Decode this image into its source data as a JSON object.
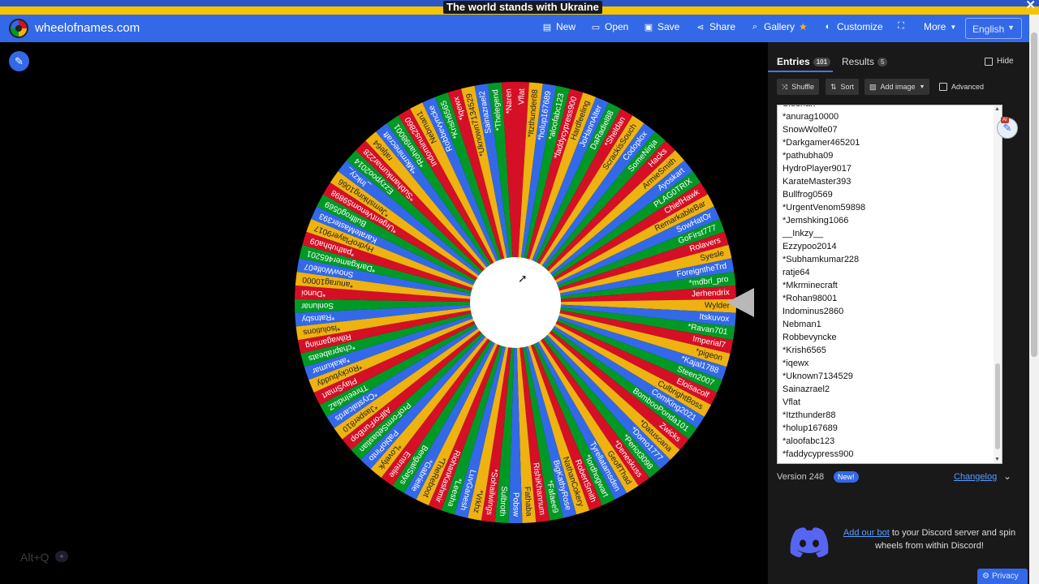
{
  "banner": {
    "text": "The world stands with Ukraine",
    "close": "✕"
  },
  "header": {
    "site_name": "wheelofnames.com",
    "nav": [
      {
        "label": "New",
        "icon": "file-icon"
      },
      {
        "label": "Open",
        "icon": "folder-icon"
      },
      {
        "label": "Save",
        "icon": "save-icon"
      },
      {
        "label": "Share",
        "icon": "share-icon"
      },
      {
        "label": "Gallery",
        "icon": "search-icon"
      },
      {
        "label": "Customize",
        "icon": "palette-icon"
      },
      {
        "label": "",
        "icon": "fullscreen-icon"
      },
      {
        "label": "More",
        "icon": "caret-down-icon"
      }
    ],
    "language": "English"
  },
  "left": {
    "shortcut": "Alt+Q",
    "shortcut_dot": "✦"
  },
  "wheel": {
    "colors": [
      "#d50f25",
      "#eeb211",
      "#3369e8",
      "#009925"
    ],
    "segments": 101,
    "labels": [
      "Vflat",
      "*Itzthunder88",
      "*holup167689",
      "*aloofabc123",
      "*faddycypress900",
      "Hardfeeling",
      "JoHannAlter",
      "DaRadiel88",
      "*Sheldan",
      "ScrackisSouch",
      "Codoplox",
      "SomeNinja",
      "Hacks",
      "ArmieSmith",
      "Ayoskart",
      "PLAG0TRIX",
      "ChiefHawk",
      "RemarkableBar",
      "SowHatOr",
      "GoFirst777",
      "Rolavers",
      "Syesle",
      "ForeigntheTrd",
      "*mdbrl_pro",
      "Jerhendrix",
      "Wylder",
      "Itskuvox",
      "*Ravan701",
      "Imperial7",
      "*pigeon",
      "*Kajal1788",
      "Steen2007",
      "Eloisacolf",
      "CulbrightBoss",
      "ComKing2021",
      "BombooPonda101",
      "Zwicks",
      "*Datuscana",
      "*Domo1777",
      "*Periot3098",
      "*Deneskuss",
      "GeoffThad",
      "Tyrellatamsden",
      "*lordhogwart",
      "RobertSmith",
      "NathanCokery",
      "BigKathyRose",
      "*Fafaee9",
      "RishiKhannum",
      "Fathaba",
      "Pobsw",
      "Sulbroth",
      "*Sohailwings",
      "*Vrkhz",
      "LuvGanesh",
      "*Leesha",
      "RiohanKashmir",
      "*TheReboot",
      "*Gabrielle",
      "BengaliSays",
      "Entrrelie",
      "*Lovelyk",
      "PabloPinto",
      "ProFormSebastian",
      "AllForFunBop",
      "*Jasper810",
      "*Crystalcards",
      "ThreeIndiaZ",
      "PlaySmart",
      "*Rockybuddy",
      "*akakumar",
      "*chaprabeats",
      "Rilwagaming",
      "*lsolutions",
      "*Ratnsby",
      "Sonlunar",
      "*Dunoi",
      "*anurag10000",
      "SnowWolfe07",
      "*Darkgamer465201",
      "*pathubha09",
      "HydroPlayer9017",
      "KarateMaster393",
      "Bullfrog0569",
      "*UrgentVenom59898",
      "*Jemshking1066",
      "_Inkzy_",
      "Ezzypoo2014",
      "*Subhamkumar228",
      "ratje64",
      "*Mkrminecraft",
      "*Rohan98001",
      "Indominus2860",
      "Nebman1",
      "Robbevyncke",
      "*Krish6565",
      "*iqewx",
      "*Uknown7134529",
      "Sainazrael2",
      "*Thelegend",
      "*Naren"
    ]
  },
  "panel": {
    "tabs": [
      {
        "label": "Entries",
        "count": "101"
      },
      {
        "label": "Results",
        "count": "5"
      }
    ],
    "hide_label": "Hide",
    "tools": {
      "shuffle": "Shuffle",
      "sort": "Sort",
      "add_image": "Add image",
      "advanced": "Advanced"
    },
    "entries": [
      "Siddhah",
      "*anurag10000",
      "SnowWolfe07",
      "*Darkgamer465201",
      "*pathubha09",
      "HydroPlayer9017",
      "KarateMaster393",
      "Bullfrog0569",
      "*UrgentVenom59898",
      "*Jemshking1066",
      "__Inkzy__",
      "Ezzypoo2014",
      "*Subhamkumar228",
      "ratje64",
      "*Mkrminecraft",
      "*Rohan98001",
      "Indominus2860",
      "Nebman1",
      "Robbevyncke",
      "*Krish6565",
      "*iqewx",
      "*Uknown7134529",
      "Sainazrael2",
      "Vflat",
      "*Itzthunder88",
      "*holup167689",
      "*aloofabc123",
      "*faddycypress900"
    ],
    "ai_tag": "AI",
    "version": "Version 248",
    "new_badge": "New!",
    "changelog": "Changelog",
    "discord_link": "Add our bot",
    "discord_text": " to your Discord server and spin wheels from within Discord!",
    "privacy": "Privacy"
  }
}
